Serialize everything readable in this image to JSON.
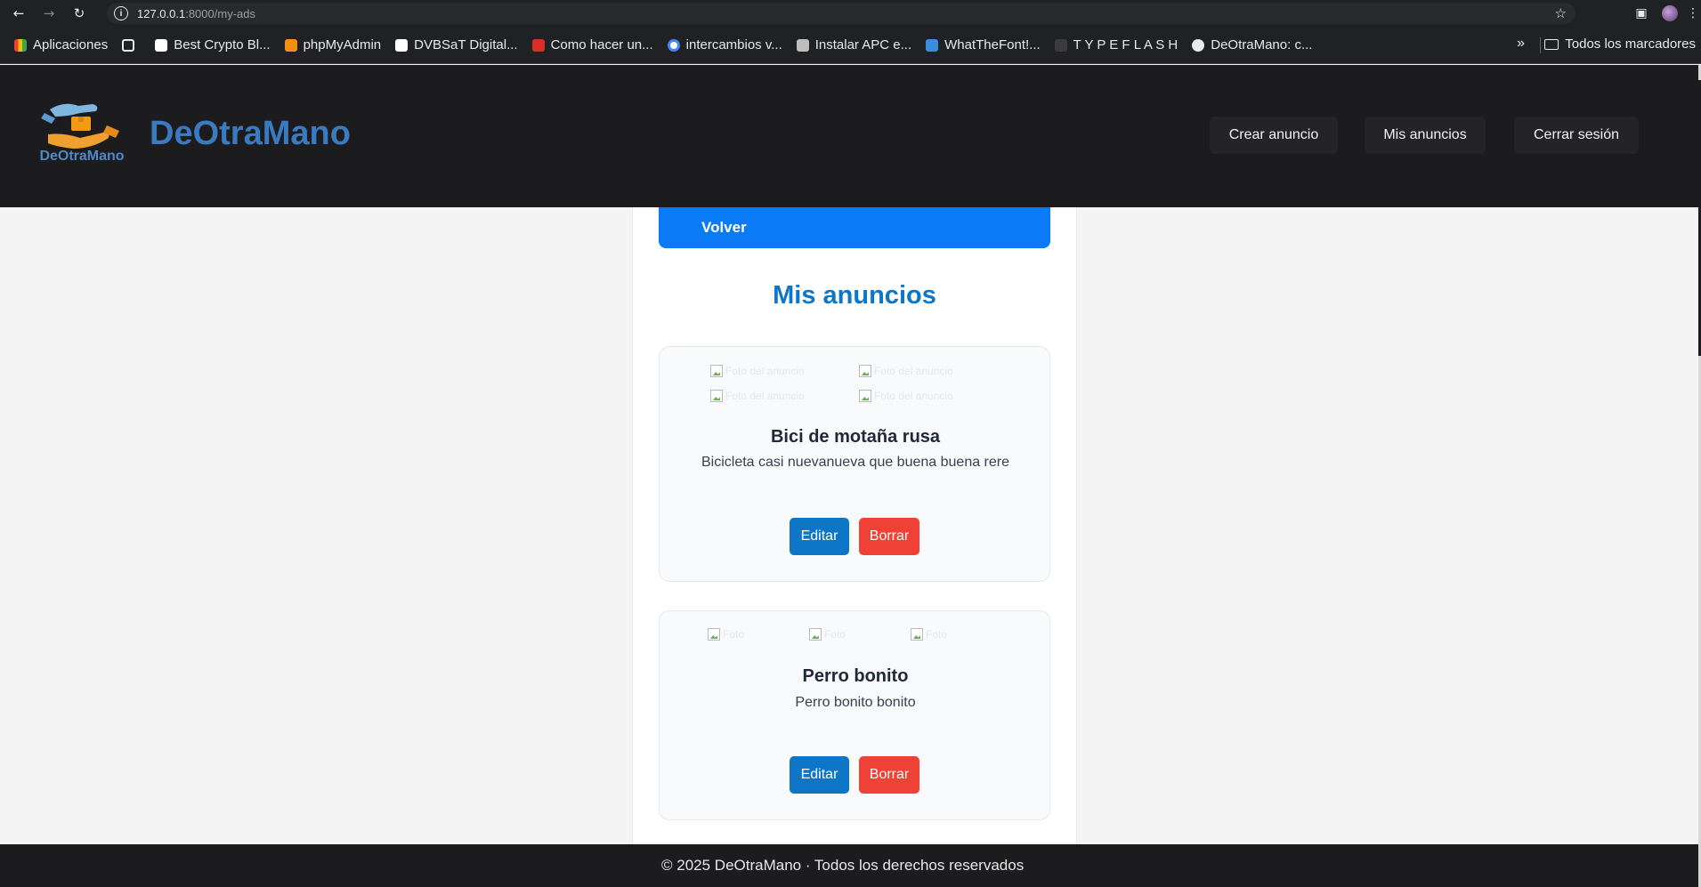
{
  "browser": {
    "url_host": "127.0.0.1",
    "url_rest": ":8000/my-ads",
    "bookmarks": [
      {
        "label": "Aplicaciones",
        "color": "#e94235"
      },
      {
        "label": "",
        "color": "#e8eaed"
      },
      {
        "label": "Best Crypto Bl...",
        "color": "#ffffff"
      },
      {
        "label": "phpMyAdmin",
        "color": "#f29111"
      },
      {
        "label": "DVBSaT Digital...",
        "color": "#ffffff"
      },
      {
        "label": "Como hacer un...",
        "color": "#d93025"
      },
      {
        "label": "intercambios v...",
        "color": "#4285f4"
      },
      {
        "label": "Instalar APC e...",
        "color": "#bdbdbd"
      },
      {
        "label": "WhatTheFont!...",
        "color": "#3a8dde"
      },
      {
        "label": "T Y P E F L A S H",
        "color": "#3c3c3c"
      },
      {
        "label": "DeOtraMano: c...",
        "color": "#e8eaed"
      }
    ],
    "more": "»",
    "all_bookmarks": "Todos los marcadores"
  },
  "header": {
    "logo_text": "DeOtraMano",
    "brand": "DeOtraMano",
    "nav": {
      "create": "Crear anuncio",
      "my_ads": "Mis anuncios",
      "logout": "Cerrar sesión"
    }
  },
  "main": {
    "back_label": "Volver",
    "title": "Mis anuncios",
    "ads": [
      {
        "title": "Bici de motaña rusa",
        "description": "Bicicleta casi nuevanueva que buena buena rere",
        "image_alt": "Foto del anuncio",
        "edit_label": "Editar",
        "delete_label": "Borrar"
      },
      {
        "title": "Perro bonito",
        "description": "Perro bonito bonito",
        "image_alt": "Foto",
        "edit_label": "Editar",
        "delete_label": "Borrar"
      }
    ]
  },
  "footer": {
    "text": "© 2025 DeOtraMano · Todos los derechos reservados"
  }
}
